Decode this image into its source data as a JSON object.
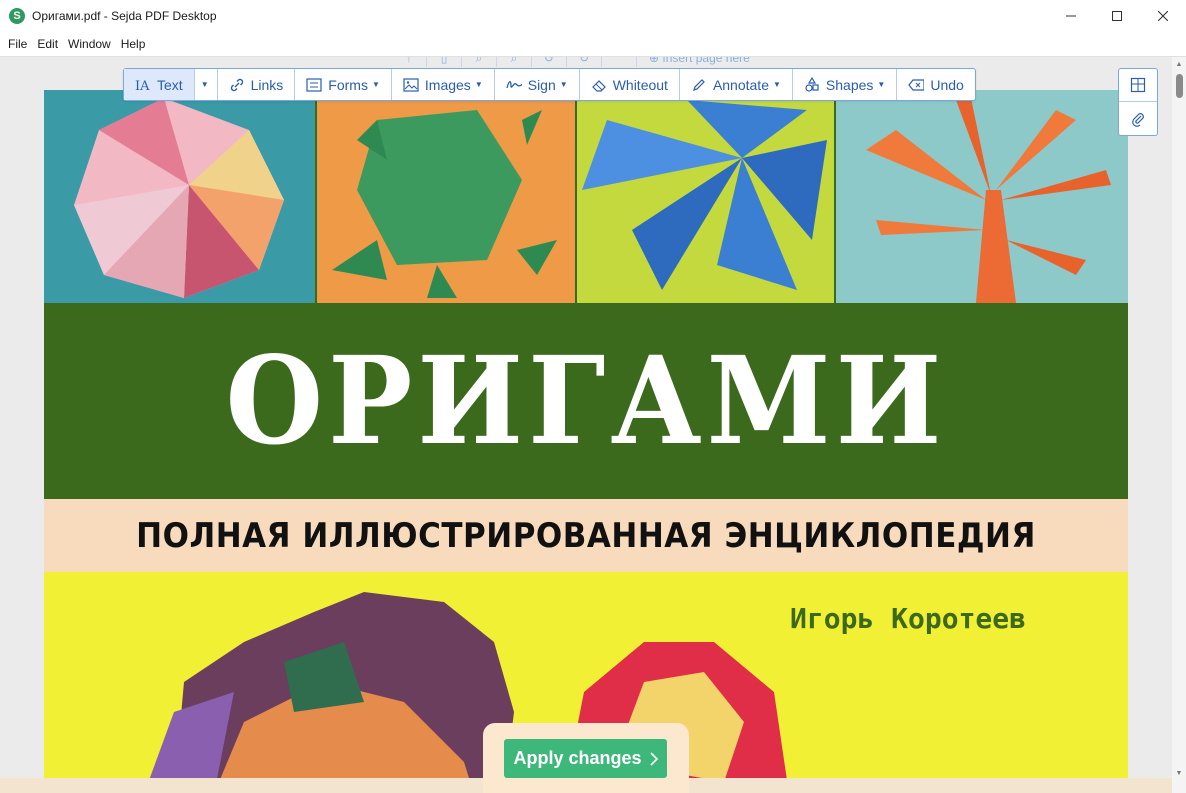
{
  "window": {
    "title": "Оригами.pdf - Sejda PDF Desktop",
    "logo_letter": "S"
  },
  "menu": [
    "File",
    "Edit",
    "Window",
    "Help"
  ],
  "ghost_toolbar": {
    "label": "Insert page here"
  },
  "toolbar": {
    "text": "Text",
    "links": "Links",
    "forms": "Forms",
    "images": "Images",
    "sign": "Sign",
    "whiteout": "Whiteout",
    "annotate": "Annotate",
    "shapes": "Shapes",
    "undo": "Undo"
  },
  "cover": {
    "title": "ОРИГАМИ",
    "subtitle": "ПОЛНАЯ ИЛЛЮСТРИРОВАННАЯ ЭНЦИКЛОПЕДИЯ",
    "author": "Игорь Коротеев"
  },
  "apply": {
    "label": "Apply changes"
  },
  "colors": {
    "accent": "#2a5db0",
    "apply": "#3db87a",
    "cover_green": "#3b6a1d",
    "cover_peach": "#f7dbbc",
    "cover_yellow": "#f2f034"
  }
}
